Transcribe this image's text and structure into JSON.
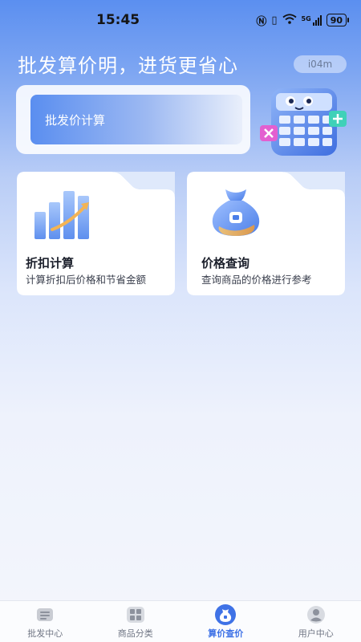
{
  "status_bar": {
    "time": "15:45",
    "network": "5G",
    "battery": "90"
  },
  "header": {
    "slogan": "批发算价明，进货更省心",
    "user_chip": "i04m"
  },
  "banner": {
    "button_label": "批发价计算"
  },
  "cards": [
    {
      "title": "折扣计算",
      "subtitle": "计算折扣后价格和节省金额"
    },
    {
      "title": "价格查询",
      "subtitle": "查询商品的价格进行参考"
    }
  ],
  "tabbar": {
    "items": [
      {
        "label": "批发中心",
        "icon": "store-icon"
      },
      {
        "label": "商品分类",
        "icon": "grid-icon"
      },
      {
        "label": "算价查价",
        "icon": "money-bag-icon",
        "active": true
      },
      {
        "label": "用户中心",
        "icon": "user-icon"
      }
    ]
  },
  "colors": {
    "accent": "#3f72e6",
    "header_bg": "#5b8ff0",
    "card_bg": "#ffffff"
  }
}
